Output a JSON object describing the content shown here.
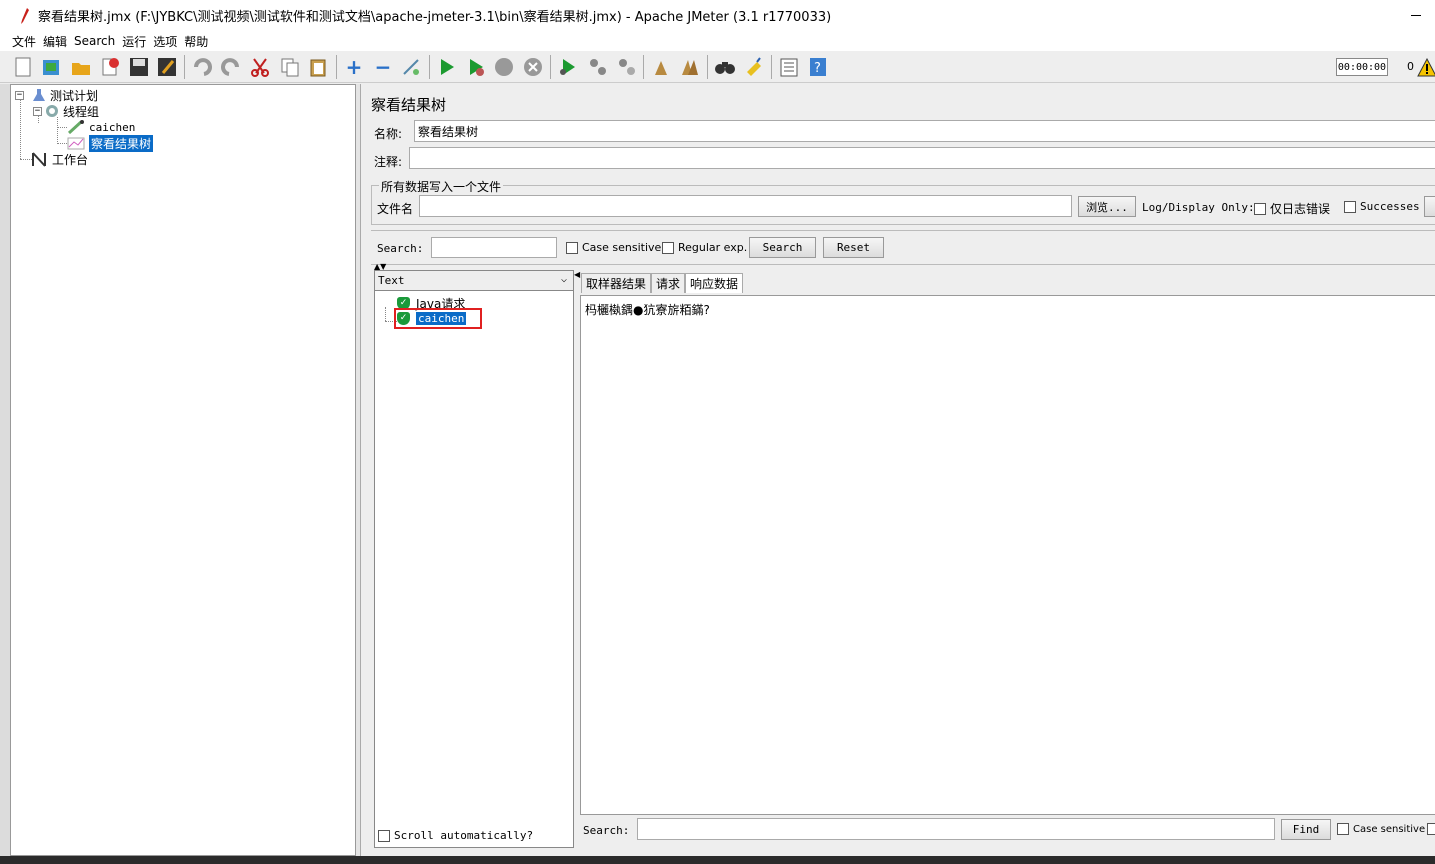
{
  "window": {
    "title": "察看结果树.jmx (F:\\JYBKC\\测试视频\\测试软件和测试文档\\apache-jmeter-3.1\\bin\\察看结果树.jmx) - Apache JMeter (3.1 r1770033)"
  },
  "menu": [
    "文件",
    "编辑",
    "Search",
    "运行",
    "选项",
    "帮助"
  ],
  "toolbar": {
    "icons": [
      "new-icon",
      "templates-icon",
      "open-icon",
      "close-icon",
      "save-icon",
      "save-as-icon",
      "undo-icon",
      "redo-icon",
      "cut-icon",
      "copy-icon",
      "paste-icon",
      "expand-icon",
      "collapse-icon",
      "toggle-icon",
      "start-icon",
      "start-no-pause-icon",
      "stop-icon",
      "shutdown-icon",
      "remote-start-icon",
      "remote-stop-icon",
      "remote-shutdown-icon",
      "clear-icon",
      "clear-all-icon",
      "search-icon",
      "reset-search-icon",
      "function-helper-icon",
      "help-icon"
    ],
    "timer": "00:00:00",
    "error_count": "0"
  },
  "tree": {
    "test_plan": "测试计划",
    "thread_group": "线程组",
    "sampler": "caichen",
    "listener": "察看结果树",
    "workbench": "工作台"
  },
  "panel": {
    "title": "察看结果树",
    "name_label": "名称:",
    "name_value": "察看结果树",
    "comment_label": "注释:",
    "comment_value": "",
    "file_group_title": "所有数据写入一个文件",
    "filename_label": "文件名",
    "browse_button": "浏览...",
    "log_display_label": "Log/Display Only:",
    "errors_only_label": "仅日志错误",
    "successes_label": "Successes"
  },
  "search": {
    "label": "Search:",
    "case_sensitive": "Case sensitive",
    "regular_exp": "Regular exp.",
    "search_button": "Search",
    "reset_button": "Reset"
  },
  "results": {
    "renderer": "Text",
    "items": [
      "Java请求",
      "caichen"
    ],
    "scroll_auto": "Scroll automatically?"
  },
  "detail": {
    "tabs": [
      "取样器结果",
      "请求",
      "响应数据"
    ],
    "active_tab": "响应数据",
    "response_text": "杩欐槸鍝●犺寮旂粨鏋?",
    "search_label": "Search:",
    "find_button": "Find",
    "case_sensitive": "Case sensitive"
  }
}
